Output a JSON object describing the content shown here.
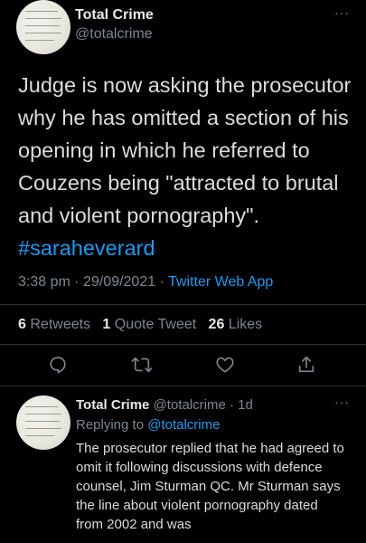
{
  "tweet": {
    "author_name": "Total Crime",
    "author_handle": "@totalcrime",
    "more": "···",
    "text": "Judge is now asking the prosecutor why he has omitted a section of his opening in which he referred to Couzens  being \"attracted to brutal and violent pornography\".",
    "hashtag": "#saraheverard",
    "time": "3:38 pm",
    "date": "29/09/2021",
    "app": "Twitter Web App",
    "stats": {
      "retweets_count": "6",
      "retweets_label": "Retweets",
      "quotes_count": "1",
      "quotes_label": "Quote Tweet",
      "likes_count": "26",
      "likes_label": "Likes"
    },
    "actions": [
      "reply-icon",
      "retweet-icon",
      "like-icon",
      "share-icon"
    ]
  },
  "reply": {
    "author_name": "Total Crime",
    "author_handle": "@totalcrime",
    "age": "1d",
    "more": "···",
    "replying_label": "Replying to",
    "replying_to": "@totalcrime",
    "text": "The prosecutor replied that he had agreed to omit it following discussions with defence counsel, Jim Sturman QC. Mr Sturman says the line about violent pornography dated from 2002 and was"
  },
  "colors": {
    "background": "#000000",
    "link": "#1d9bf0",
    "muted": "#7c8790",
    "divider": "#2f3336"
  }
}
